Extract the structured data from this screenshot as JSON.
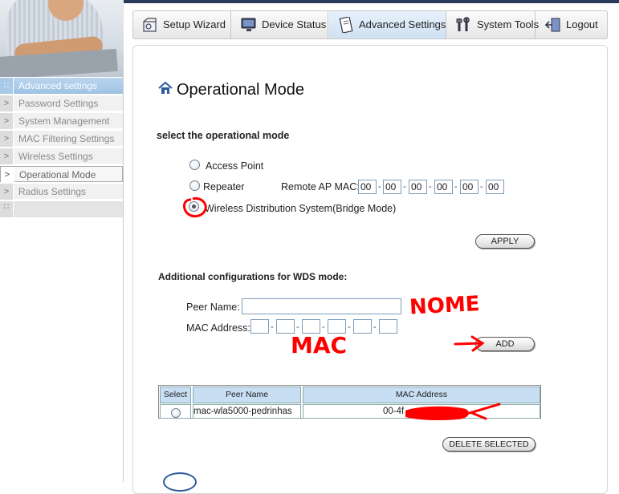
{
  "sidebar": {
    "header": "Advanced settings",
    "items": [
      {
        "label": "Password Settings",
        "active": false
      },
      {
        "label": "System Management",
        "active": false
      },
      {
        "label": "MAC Filtering Settings",
        "active": false
      },
      {
        "label": "Wireless Settings",
        "active": false
      },
      {
        "label": "Operational Mode",
        "active": true
      },
      {
        "label": "Radius Settings",
        "active": false
      }
    ]
  },
  "tabs": [
    {
      "label": "Setup Wizard",
      "icon": "setup-wizard-icon"
    },
    {
      "label": "Device Status",
      "icon": "monitor-icon"
    },
    {
      "label": "Advanced Settings",
      "icon": "document-icon",
      "active": true
    },
    {
      "label": "System Tools",
      "icon": "tools-icon"
    },
    {
      "label": "Logout",
      "icon": "logout-icon"
    }
  ],
  "page": {
    "title": "Operational Mode",
    "mode_section_label": "select the operational mode",
    "modes": [
      {
        "label": "Access Point",
        "checked": false
      },
      {
        "label": "Repeater",
        "checked": false
      },
      {
        "label": "Wireless Distribution System(Bridge Mode)",
        "checked": true
      }
    ],
    "remote_ap_label": "Remote AP MAC:",
    "remote_ap_mac": [
      "00",
      "00",
      "00",
      "00",
      "00",
      "00"
    ],
    "mac_separator": "-",
    "apply_label": "APPLY",
    "wds_section_label": "Additional configurations for WDS mode:",
    "peer_name_label": "Peer Name:",
    "peer_name_value": "",
    "mac_address_label": "MAC Address:",
    "mac_address_values": [
      "",
      "",
      "",
      "",
      "",
      ""
    ],
    "add_label": "ADD",
    "table": {
      "headers": [
        "Select",
        "Peer Name",
        "MAC Address"
      ],
      "rows": [
        {
          "peer_name": "mac-wla5000-pedrinhas",
          "mac": "00-4f"
        }
      ]
    },
    "delete_label": "DELETE SELECTED",
    "annotations": {
      "name_note": "NOME",
      "mac_note": "MAC"
    }
  },
  "colors": {
    "tab_active": "#cfe1f3",
    "sidebar_header": "#9fc2e3",
    "table_header": "#c7def3",
    "scribble": "#ff0000"
  }
}
